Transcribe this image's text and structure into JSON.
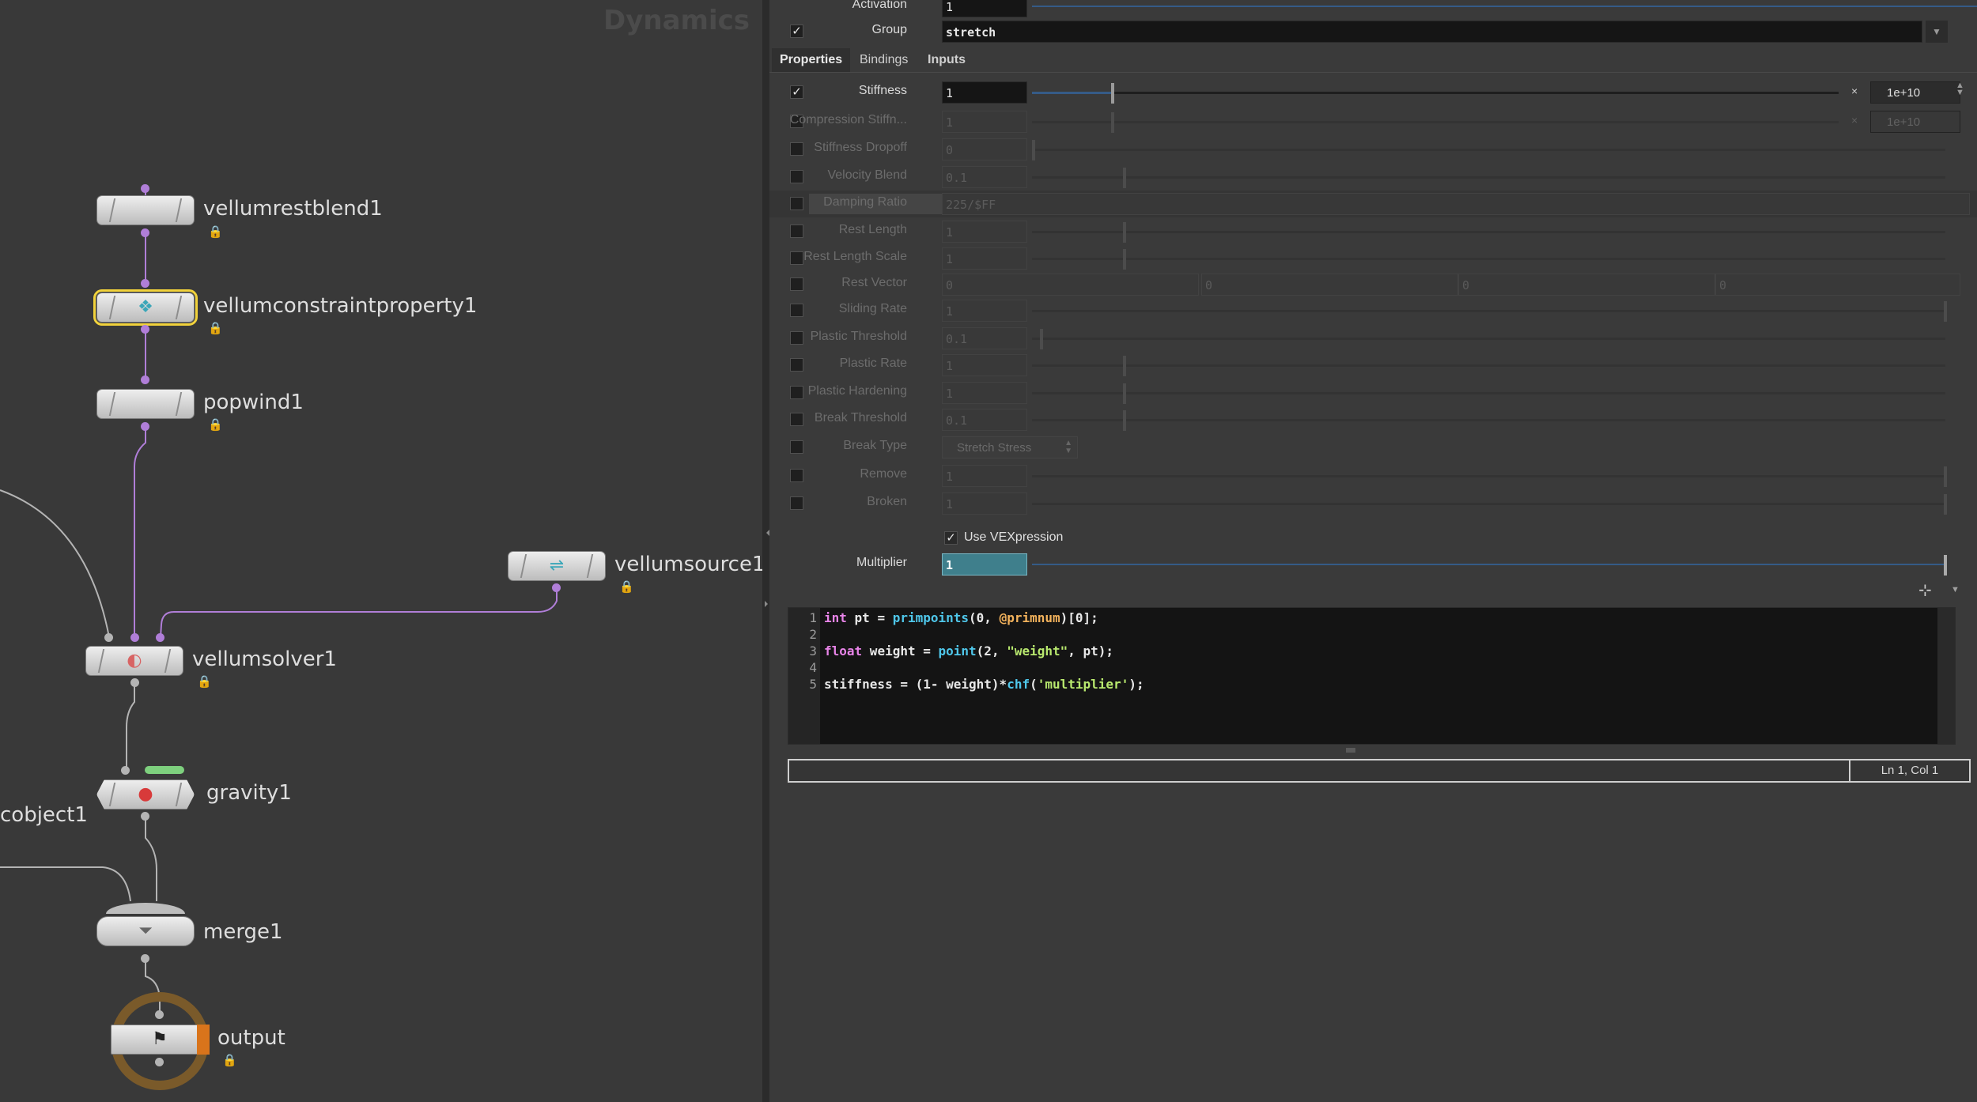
{
  "network": {
    "context": "Dynamics",
    "nodes": {
      "vellumrestblend1": "vellumrestblend1",
      "vellumconstraintproperty1": "vellumconstraintproperty1",
      "popwind1": "popwind1",
      "vellumsource1": "vellumsource1",
      "vellumsolver1": "vellumsolver1",
      "gravity1": "gravity1",
      "cobject1": "cobject1",
      "merge1": "merge1",
      "output": "output"
    }
  },
  "params": {
    "activation": {
      "label": "Activation",
      "value": "1"
    },
    "group": {
      "label": "Group",
      "value": "stretch"
    },
    "tabs": [
      "Properties",
      "Bindings",
      "Inputs"
    ],
    "active_tab": "Properties",
    "stiffness": {
      "label": "Stiffness",
      "value": "1",
      "max": "1e+10"
    },
    "compression": {
      "label": "Compression Stiffn...",
      "value": "1",
      "max": "1e+10"
    },
    "stiffness_dropoff": {
      "label": "Stiffness Dropoff",
      "value": "0"
    },
    "velocity_blend": {
      "label": "Velocity Blend",
      "value": "0.1"
    },
    "damping_ratio": {
      "label": "Damping Ratio",
      "value": "225/$FF"
    },
    "rest_length": {
      "label": "Rest Length",
      "value": "1"
    },
    "rest_length_scale": {
      "label": "Rest Length Scale",
      "value": "1"
    },
    "rest_vector": {
      "label": "Rest Vector",
      "values": [
        "0",
        "0",
        "0",
        "0"
      ]
    },
    "sliding_rate": {
      "label": "Sliding Rate",
      "value": "1"
    },
    "plastic_threshold": {
      "label": "Plastic Threshold",
      "value": "0.1"
    },
    "plastic_rate": {
      "label": "Plastic Rate",
      "value": "1"
    },
    "plastic_hardening": {
      "label": "Plastic Hardening",
      "value": "1"
    },
    "break_threshold": {
      "label": "Break Threshold",
      "value": "0.1"
    },
    "break_type": {
      "label": "Break Type",
      "value": "Stretch Stress"
    },
    "remove": {
      "label": "Remove",
      "value": "1"
    },
    "broken": {
      "label": "Broken",
      "value": "1"
    },
    "use_vexpression": {
      "label": "Use VEXpression",
      "checked": true
    },
    "multiplier": {
      "label": "Multiplier",
      "value": "1"
    }
  },
  "code": {
    "line_numbers": [
      "1",
      "2",
      "3",
      "4",
      "5"
    ],
    "l1": {
      "kw": "int",
      "a": " pt = ",
      "fn": "primpoints",
      "b": "(0, ",
      "at": "@primnum",
      "c": ")[0];"
    },
    "l3": {
      "kw": "float",
      "a": " weight = ",
      "fn": "point",
      "b": "(2, ",
      "st": "\"weight\"",
      "c": ", pt);"
    },
    "l5": {
      "a": "stiffness = (1- weight)*",
      "fn": "chf",
      "b": "(",
      "st": "'multiplier'",
      "c": ");"
    },
    "cursor": "Ln 1, Col 1"
  },
  "colors": {
    "wire": "#b07ed8",
    "selected_outline": "#f1d23c",
    "gravity_badge": "#7ed07e",
    "output_ring": "#7a5a2a"
  }
}
